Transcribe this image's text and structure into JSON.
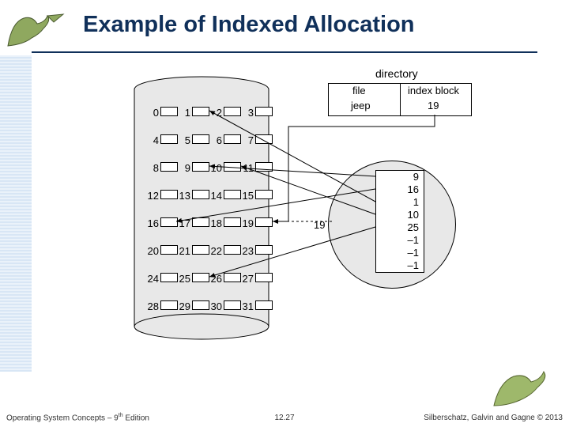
{
  "title": "Example of Indexed Allocation",
  "dir": {
    "label": "directory",
    "col1": "file",
    "col2": "index block",
    "file": "jeep",
    "ib": "19"
  },
  "blocks": [
    "0",
    "1",
    "2",
    "3",
    "4",
    "5",
    "6",
    "7",
    "8",
    "9",
    "10",
    "11",
    "12",
    "13",
    "14",
    "15",
    "16",
    "17",
    "18",
    "19",
    "20",
    "21",
    "22",
    "23",
    "24",
    "25",
    "26",
    "27",
    "28",
    "29",
    "30",
    "31"
  ],
  "indexBlock": {
    "label": "19",
    "entries": [
      "9",
      "16",
      "1",
      "10",
      "25",
      "–1",
      "–1",
      "–1"
    ]
  },
  "footer": {
    "left_a": "Operating System Concepts – 9",
    "left_b": " Edition",
    "sup": "th",
    "mid": "12.27",
    "right": "Silberschatz, Galvin and Gagne © 2013"
  }
}
